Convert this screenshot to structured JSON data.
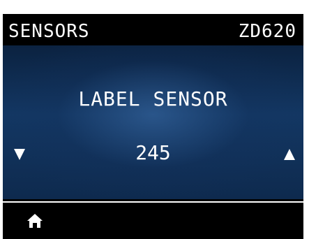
{
  "header": {
    "title": "SENSORS",
    "model": "ZD620"
  },
  "sensor": {
    "label": "LABEL SENSOR",
    "value": "245"
  },
  "controls": {
    "decrease_icon": "down-triangle-icon",
    "increase_icon": "up-triangle-icon",
    "home_icon": "home-icon"
  },
  "colors": {
    "text": "#ffffff",
    "background": "#000000",
    "panel": "#133763"
  }
}
